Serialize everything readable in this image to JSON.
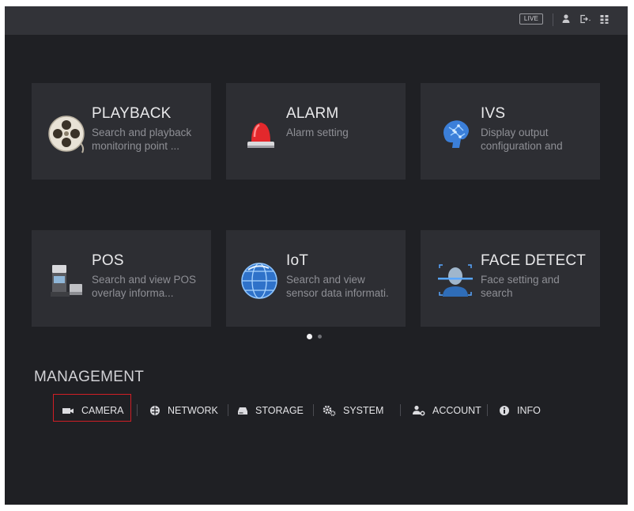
{
  "topbar": {
    "live_label": "LIVE",
    "icons": [
      "user-icon",
      "logout-icon",
      "grid-icon"
    ]
  },
  "tiles": [
    {
      "title": "PLAYBACK",
      "desc1": "Search and playback",
      "desc2": "monitoring point ...",
      "icon": "film-reel-icon"
    },
    {
      "title": "ALARM",
      "desc1": "Alarm setting",
      "desc2": "",
      "icon": "alarm-light-icon"
    },
    {
      "title": "IVS",
      "desc1": "Display output",
      "desc2": "configuration and",
      "icon": "brain-icon"
    },
    {
      "title": "POS",
      "desc1": "Search and view POS",
      "desc2": "overlay informa...",
      "icon": "pos-terminal-icon"
    },
    {
      "title": "IoT",
      "desc1": "Search and view",
      "desc2": "sensor data informati.",
      "icon": "globe-icon"
    },
    {
      "title": "FACE DETECT",
      "desc1": "Face setting and",
      "desc2": "search",
      "icon": "face-scan-icon"
    }
  ],
  "pagination": {
    "count": 2,
    "active": 1
  },
  "management": {
    "title": "MANAGEMENT",
    "items": [
      {
        "label": "CAMERA",
        "icon": "camera-icon",
        "selected": true
      },
      {
        "label": "NETWORK",
        "icon": "network-icon"
      },
      {
        "label": "STORAGE",
        "icon": "storage-icon"
      },
      {
        "label": "SYSTEM",
        "icon": "gears-icon"
      },
      {
        "label": "ACCOUNT",
        "icon": "account-icon"
      },
      {
        "label": "INFO",
        "icon": "info-icon"
      }
    ]
  },
  "colors": {
    "background": "#1f2024",
    "tile": "#2d2e33",
    "topbar": "#323338",
    "highlight": "#d01e25"
  }
}
